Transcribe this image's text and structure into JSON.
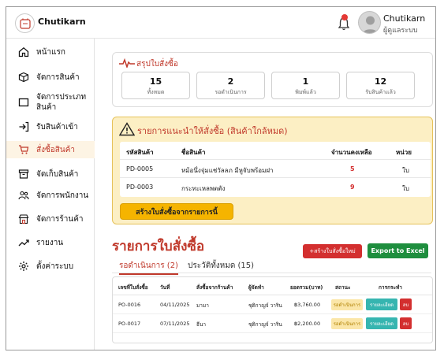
{
  "header": {
    "brand": "Chutikarn",
    "user_name": "Chutikarn",
    "user_role": "ผู้ดูแลระบบ",
    "notification_count": ""
  },
  "sidebar": {
    "items": [
      {
        "label": "หน้าแรก",
        "icon": "home-icon"
      },
      {
        "label": "จัดการสินค้า",
        "icon": "box-icon"
      },
      {
        "label": "จัดการประเภทสินค้า",
        "icon": "folder-icon"
      },
      {
        "label": "รับสินค้าเข้า",
        "icon": "login-icon"
      },
      {
        "label": "สั่งซื้อสินค้า",
        "icon": "cart-icon",
        "active": true
      },
      {
        "label": "จัดเก็บสินค้า",
        "icon": "archive-icon"
      },
      {
        "label": "จัดการพนักงาน",
        "icon": "users-icon"
      },
      {
        "label": "จัดการร้านค้า",
        "icon": "store-icon"
      },
      {
        "label": "รายงาน",
        "icon": "trend-icon"
      },
      {
        "label": "ตั้งค่าระบบ",
        "icon": "gear-icon"
      }
    ]
  },
  "summary": {
    "title": "สรุปใบสั่งซื้อ",
    "stats": [
      {
        "value": "15",
        "label": "ทั้งหมด"
      },
      {
        "value": "2",
        "label": "รอดำเนินการ"
      },
      {
        "value": "1",
        "label": "พิมพ์แล้ว"
      },
      {
        "value": "12",
        "label": "รับสินค้าแล้ว"
      }
    ]
  },
  "recommend": {
    "title": "รายการแนะนำให้สั่งซื้อ (สินค้าใกล้หมด)",
    "columns": [
      "รหัสสินค้า",
      "ชื่อสินค้า",
      "จำนวนคงเหลือ",
      "หน่วย"
    ],
    "rows": [
      {
        "code": "PD-0005",
        "name": "หม้อนึ่งจุ่มแช่วัลลภ มีหูจับพร้อมฝา",
        "qty": "5",
        "unit": "ใบ"
      },
      {
        "code": "PD-0003",
        "name": "กระทะเหลพตตัง",
        "qty": "9",
        "unit": "ใบ"
      }
    ],
    "create_button": "สร้างใบสั่งซื้อจากรายการนี้"
  },
  "orders": {
    "title": "รายการใบสั่งซื้อ",
    "new_button": "+สร้างใบสั่งซื้อใหม่",
    "excel_button": "Export to Excel",
    "tabs": [
      {
        "label": "รอดำเนินการ (2)",
        "active": true
      },
      {
        "label": "ประวัติทั้งหมด (15)",
        "active": false
      }
    ],
    "columns": [
      "เลขที่ใบสั่งซื้อ",
      "วันที่",
      "สั่งซื้อจากร้านค้า",
      "ผู้จัดทำ",
      "ยอดรวม(บาท)",
      "สถานะ",
      "การกระทำ"
    ],
    "rows": [
      {
        "po": "PO-0016",
        "date": "04/11/2025",
        "store": "มามา",
        "by": "ชุติกาญจ์ วาริน",
        "total": "฿3,760.00",
        "status": "รอดำเนินการ",
        "detail": "รายละเอียด",
        "del": "ลบ"
      },
      {
        "po": "PO-0017",
        "date": "07/11/2025",
        "store": "ธีนา",
        "by": "ชุติกาญจ์ วาริน",
        "total": "฿2,200.00",
        "status": "รอดำเนินการ",
        "detail": "รายละเอียด",
        "del": "ลบ"
      }
    ]
  },
  "colors": {
    "accent": "#c0392b",
    "warning_bg": "#fcefc4",
    "warning_button": "#f5b400",
    "excel_green": "#1e8e3e",
    "detail_teal": "#36b5b0",
    "delete_red": "#d32f2f"
  }
}
